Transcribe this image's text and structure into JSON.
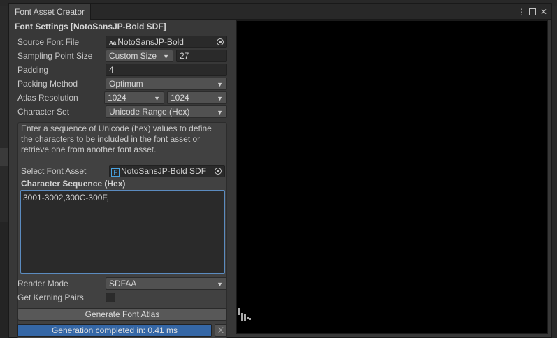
{
  "window": {
    "title": "Font Asset Creator"
  },
  "header": {
    "title": "Font Settings [NotoSansJP-Bold SDF]"
  },
  "settings": {
    "source_font_file": {
      "label": "Source Font File",
      "value": "NotoSansJP-Bold",
      "icon": "font-file-icon"
    },
    "sampling_point_size": {
      "label": "Sampling Point Size",
      "mode": "Custom Size",
      "value": "27"
    },
    "padding": {
      "label": "Padding",
      "value": "4"
    },
    "packing_method": {
      "label": "Packing Method",
      "value": "Optimum"
    },
    "atlas_resolution": {
      "label": "Atlas Resolution",
      "width": "1024",
      "height": "1024"
    },
    "character_set": {
      "label": "Character Set",
      "value": "Unicode Range (Hex)"
    }
  },
  "unicode_box": {
    "help_text": "Enter a sequence of Unicode (hex) values to define the characters to be included in the font asset or retrieve one from another font asset.",
    "select_font_asset": {
      "label": "Select Font Asset",
      "value": "NotoSansJP-Bold SDF"
    },
    "sequence_title": "Character Sequence (Hex)",
    "sequence_value": "3001-3002,300C-300F,"
  },
  "render_mode": {
    "label": "Render Mode",
    "value": "SDFAA"
  },
  "kerning": {
    "label": "Get Kerning Pairs",
    "checked": false
  },
  "generate_button": {
    "label": "Generate Font Atlas"
  },
  "progress": {
    "text": "Generation completed in: 0.41 ms",
    "fraction": 1.0,
    "close_label": "X"
  },
  "colors": {
    "accent": "#3567a6",
    "panel": "#383838",
    "field": "#2a2a2a",
    "focus_border": "#5b8bbf"
  }
}
